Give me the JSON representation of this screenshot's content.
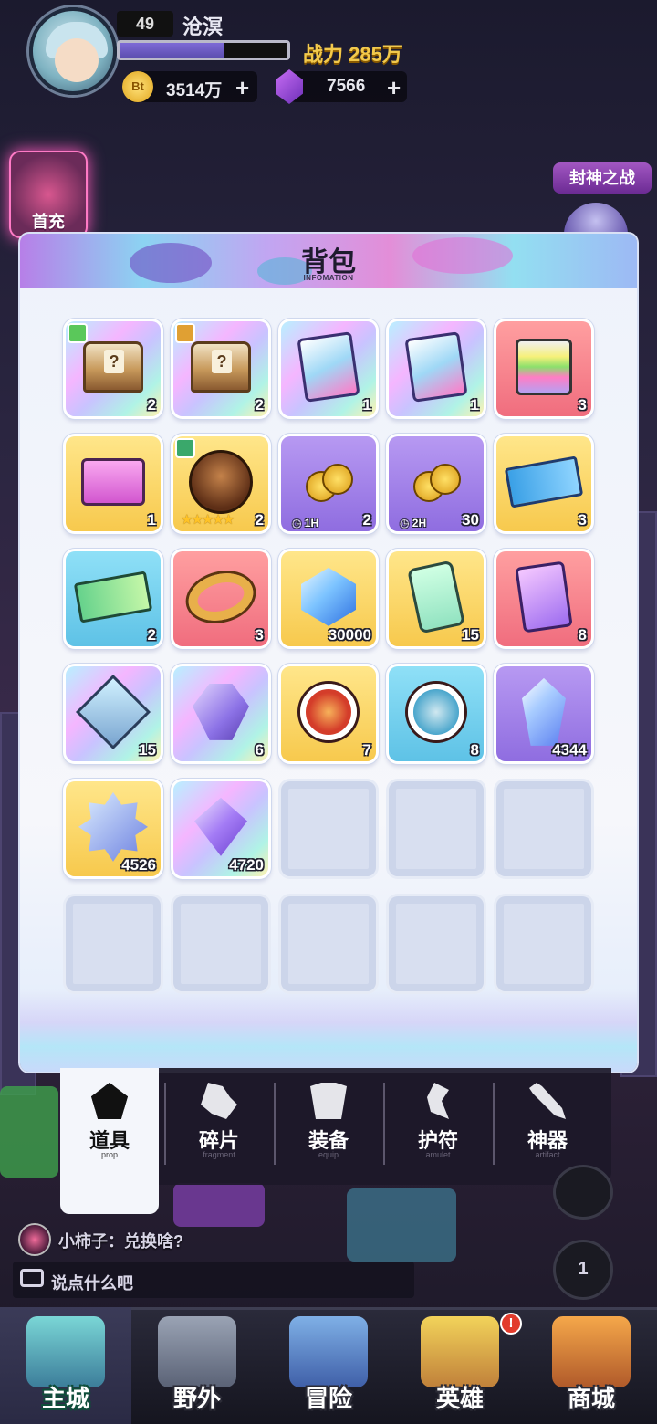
{
  "player": {
    "level": "49",
    "name": "沧溟",
    "xp_fraction": 0.62,
    "power_label": "战力 285万"
  },
  "currency": {
    "coin_icon_text": "Bt",
    "coins": "3514万",
    "gems": "7566",
    "plus": "+"
  },
  "events": {
    "first_charge": "首充",
    "feng_shen": "封神之战"
  },
  "backpack": {
    "title": "背包",
    "subtitle": "INFOMATION",
    "items": [
      {
        "name": "mystery-chest-rainbow",
        "icon": "chest-icon",
        "bg": "rainbow",
        "count": "2",
        "badge": "#5ac85a"
      },
      {
        "name": "mystery-chest-rainbow-2",
        "icon": "chest-icon",
        "bg": "rainbow",
        "count": "2",
        "badge": "#e0a033"
      },
      {
        "name": "card-pack",
        "icon": "card-pack-icon",
        "bg": "rainbow",
        "count": "1"
      },
      {
        "name": "card-pack-2",
        "icon": "card-pack-icon",
        "bg": "rainbow",
        "count": "1"
      },
      {
        "name": "rainbow-cube",
        "icon": "cube-icon",
        "bg": "red",
        "count": "3"
      },
      {
        "name": "pink-gift-box",
        "icon": "gift-box-icon",
        "bg": "gold",
        "count": "1"
      },
      {
        "name": "hero-fragment",
        "icon": "hero-icon",
        "bg": "gold",
        "count": "2",
        "stars": "★★★★★",
        "badge": "#3aa86b"
      },
      {
        "name": "coin-boost-1h",
        "icon": "coins-icon",
        "bg": "purple",
        "count": "2",
        "tag": "1H"
      },
      {
        "name": "coin-boost-2h",
        "icon": "coins-icon",
        "bg": "purple",
        "count": "30",
        "tag": "2H"
      },
      {
        "name": "blue-ticket",
        "icon": "ticket-icon",
        "bg": "gold",
        "count": "3"
      },
      {
        "name": "green-ticket",
        "icon": "ticket-icon",
        "bg": "blue",
        "count": "2"
      },
      {
        "name": "golden-ring",
        "icon": "ring-icon",
        "bg": "red",
        "count": "3"
      },
      {
        "name": "blue-gem",
        "icon": "gem-icon",
        "bg": "gold",
        "count": "30000"
      },
      {
        "name": "device-card",
        "icon": "phone-icon",
        "bg": "gold",
        "count": "15"
      },
      {
        "name": "planet-card",
        "icon": "planet-card-icon",
        "bg": "red",
        "count": "8"
      },
      {
        "name": "diamond-frame",
        "icon": "diamond-frame-icon",
        "bg": "rainbow",
        "count": "15"
      },
      {
        "name": "purple-crystal-block",
        "icon": "crystal-icon",
        "bg": "rainbow",
        "count": "6"
      },
      {
        "name": "red-chip",
        "icon": "chip-icon",
        "bg": "gold",
        "count": "7"
      },
      {
        "name": "blue-chip",
        "icon": "chip-icon",
        "bg": "blue",
        "count": "8"
      },
      {
        "name": "blue-crystal",
        "icon": "crystal-icon",
        "bg": "purple",
        "count": "4344"
      },
      {
        "name": "star-badge",
        "icon": "star-badge-icon",
        "bg": "gold",
        "count": "4526"
      },
      {
        "name": "purple-gem",
        "icon": "gem-icon",
        "bg": "rainbow",
        "count": "4720"
      }
    ]
  },
  "tabs": [
    {
      "label": "道具",
      "sub": "prop",
      "icon": "pentagon-icon",
      "active": true
    },
    {
      "label": "碎片",
      "sub": "fragment",
      "icon": "puzzle-icon"
    },
    {
      "label": "装备",
      "sub": "equip",
      "icon": "armor-icon"
    },
    {
      "label": "护符",
      "sub": "amulet",
      "icon": "amulet-icon"
    },
    {
      "label": "神器",
      "sub": "artifact",
      "icon": "sword-icon"
    }
  ],
  "chat": {
    "last_message": "小柿子：兑换啥?",
    "placeholder": "说点什么吧",
    "side_button": "1"
  },
  "nav": {
    "items": [
      "主城",
      "野外",
      "冒险",
      "英雄",
      "商城"
    ],
    "hero_alert": "!"
  }
}
